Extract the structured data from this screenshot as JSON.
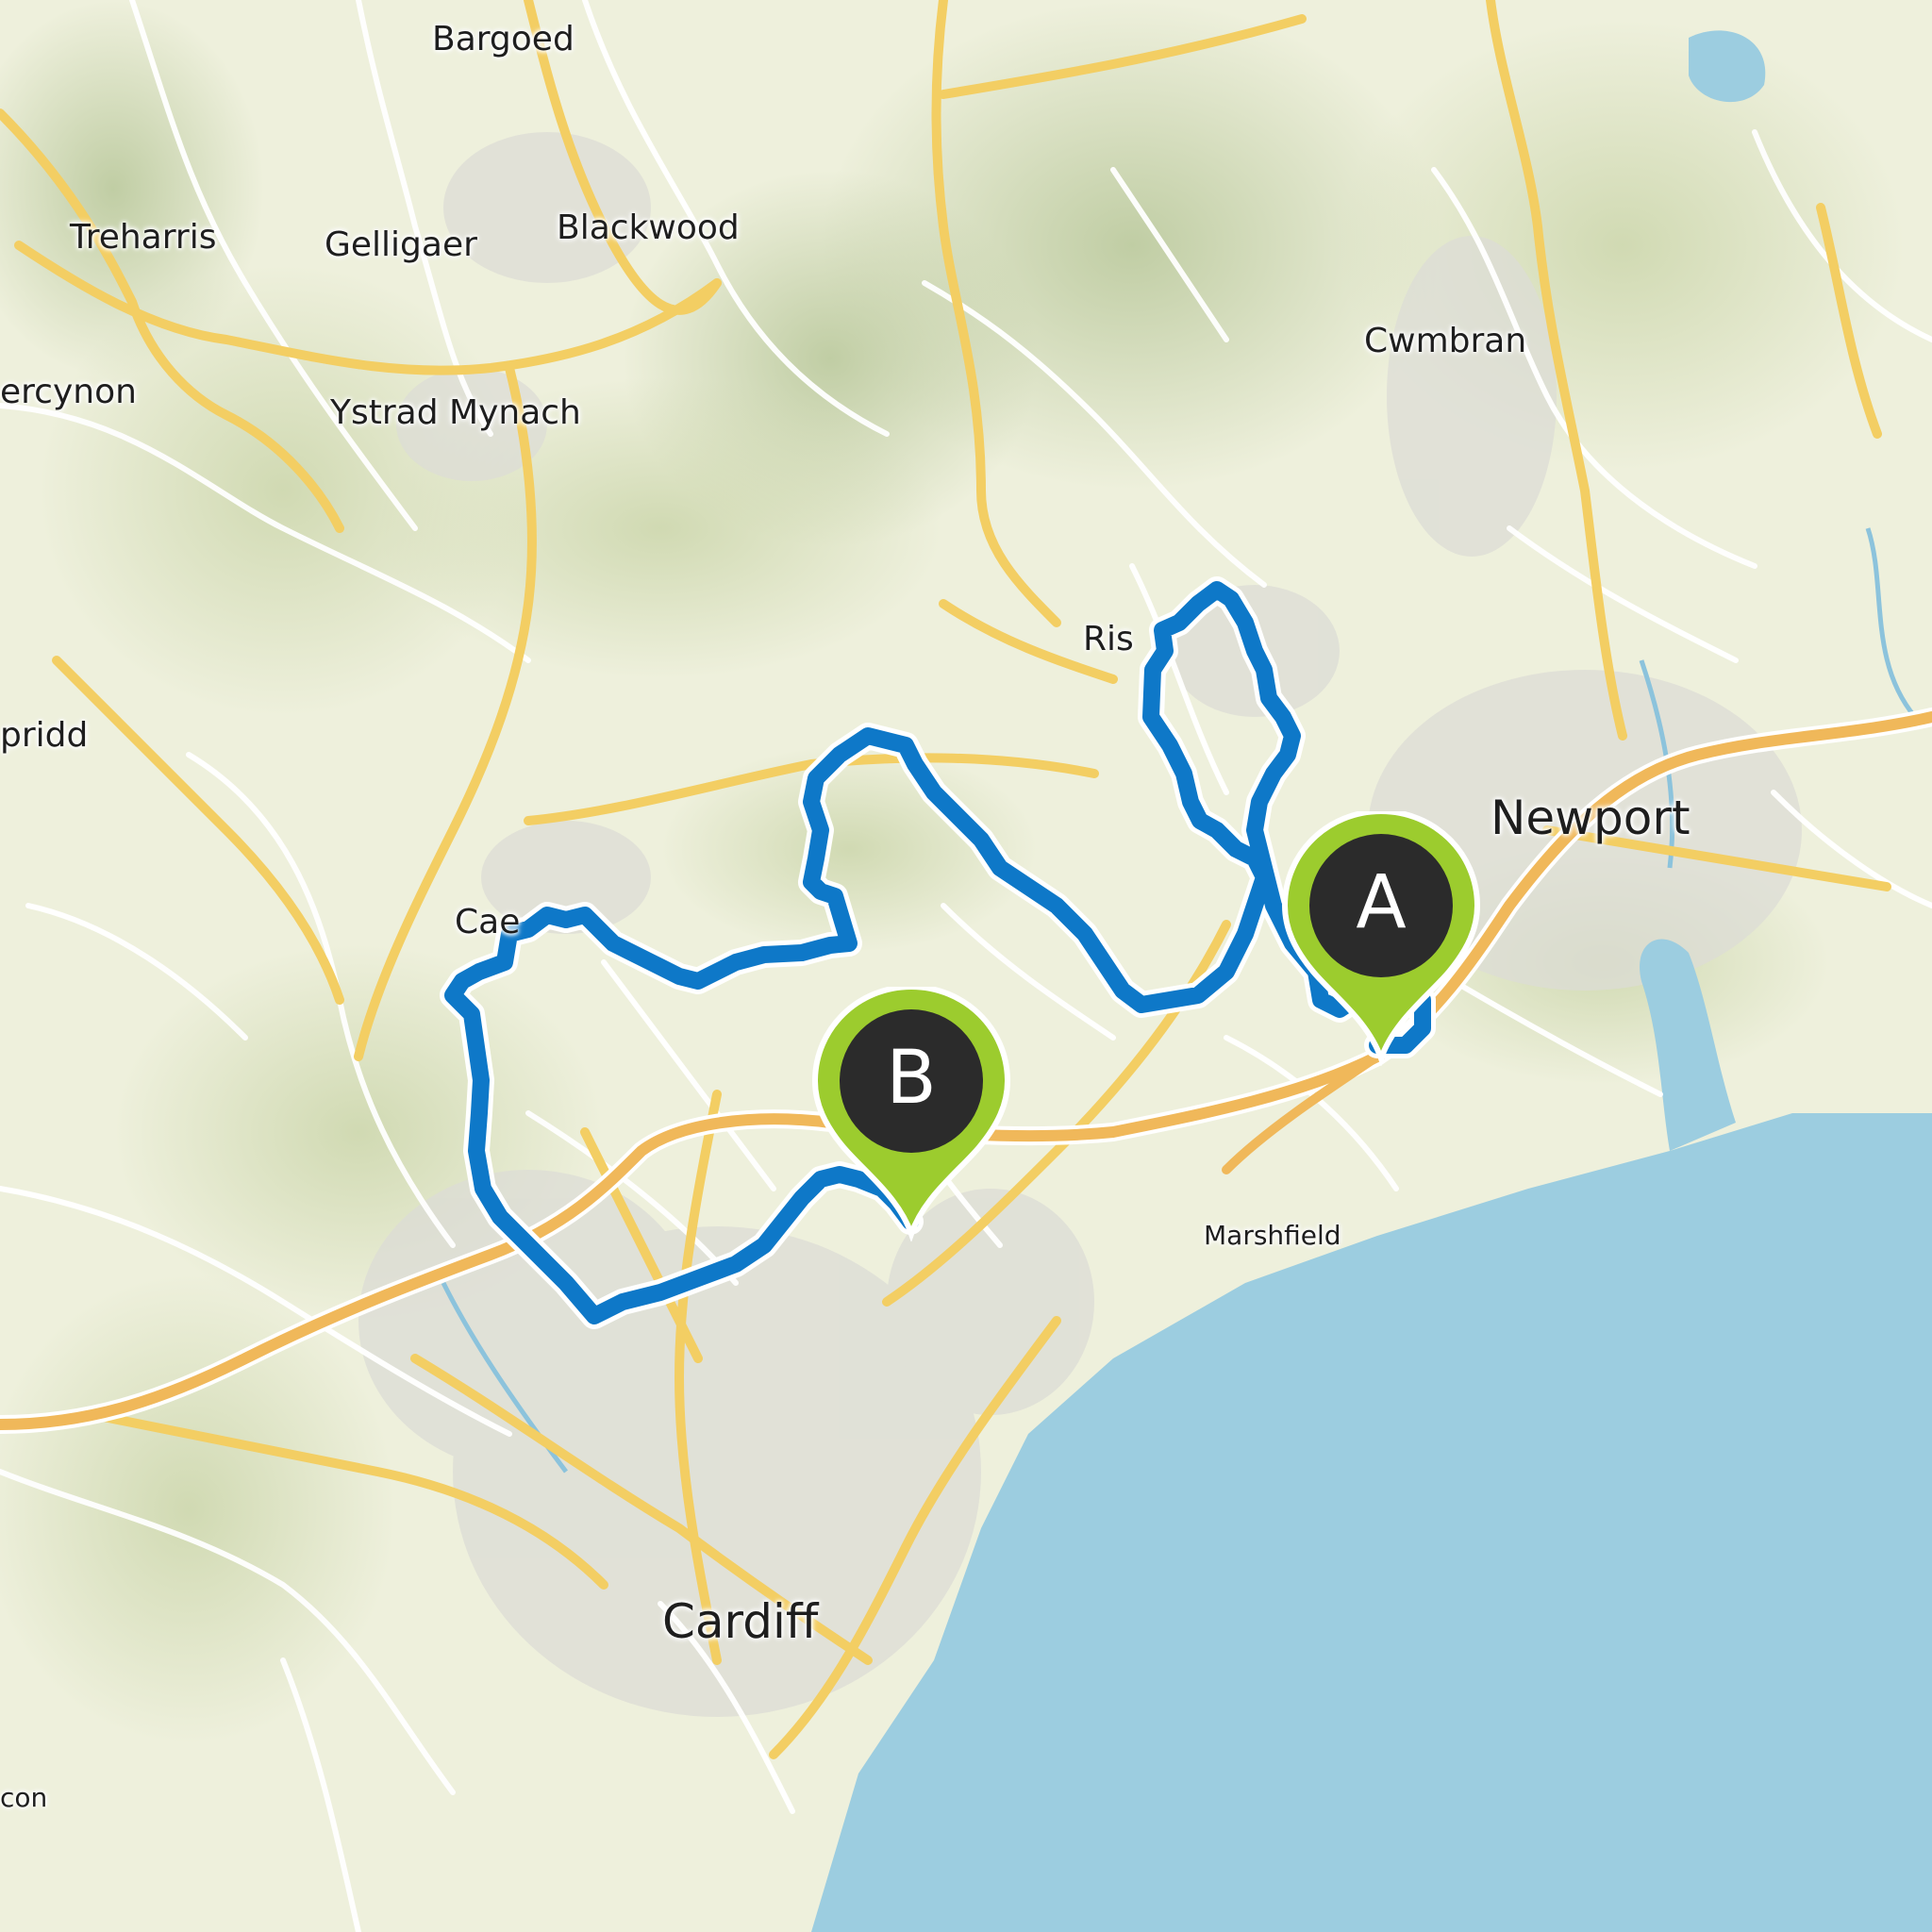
{
  "map": {
    "places": [
      {
        "name": "Bargoed",
        "kind": "town"
      },
      {
        "name": "Treharris",
        "kind": "town"
      },
      {
        "name": "Gelligaer",
        "kind": "town"
      },
      {
        "name": "Blackwood",
        "kind": "town"
      },
      {
        "name": "Cwmbran",
        "kind": "town"
      },
      {
        "name": "ercynon",
        "kind": "town"
      },
      {
        "name": "Ystrad Mynach",
        "kind": "town"
      },
      {
        "name": "Ris",
        "kind": "town"
      },
      {
        "name": "Newport",
        "kind": "city"
      },
      {
        "name": "pridd",
        "kind": "town"
      },
      {
        "name": "Cae",
        "kind": "town"
      },
      {
        "name": "Marshfield",
        "kind": "village"
      },
      {
        "name": "Cardiff",
        "kind": "city"
      },
      {
        "name": "con",
        "kind": "village"
      }
    ],
    "markers": [
      {
        "label": "A",
        "role": "start"
      },
      {
        "label": "B",
        "role": "finish"
      }
    ],
    "colors": {
      "land": "#eef0dc",
      "sea": "#9ccde0",
      "route": "#0e78c8",
      "marker_pin": "#9ccc2e",
      "marker_center": "#2b2b2b",
      "major_road": "#f3ce63",
      "motorway": "#f0b85a",
      "minor_road": "#ffffff"
    }
  }
}
